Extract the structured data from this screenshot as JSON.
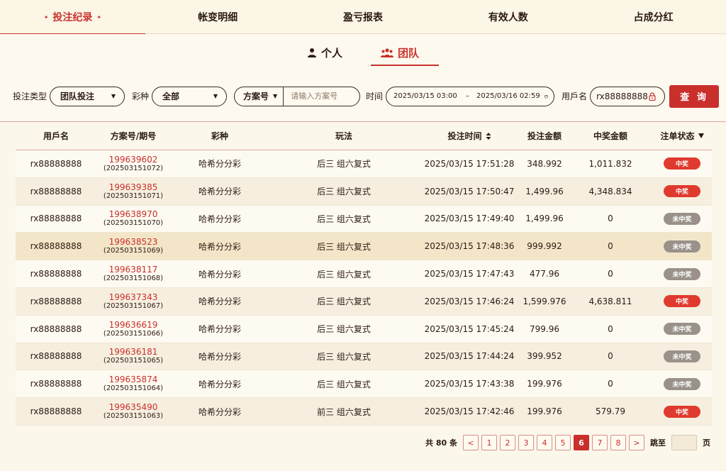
{
  "top_tabs": [
    {
      "label": "投注纪录",
      "active": true
    },
    {
      "label": "帐变明细",
      "active": false
    },
    {
      "label": "盈亏报表",
      "active": false
    },
    {
      "label": "有效人数",
      "active": false
    },
    {
      "label": "占成分红",
      "active": false
    }
  ],
  "sub_tabs": {
    "personal": "个人",
    "team": "团队"
  },
  "filters": {
    "bet_type_label": "投注类型",
    "bet_type_value": "团队投注",
    "lottery_label": "彩种",
    "lottery_value": "全部",
    "plan_select_value": "方案号",
    "plan_input_placeholder": "请输入方案号",
    "time_label": "时间",
    "time_start": "2025/03/15 03:00",
    "time_separator": "–",
    "time_end": "2025/03/16 02:59",
    "username_label": "用戶名",
    "username_value": "rx88888888",
    "query_button": "查 询"
  },
  "table": {
    "headers": {
      "user": "用戶名",
      "plan": "方案号/期号",
      "lottery": "彩种",
      "play": "玩法",
      "time": "投注时间",
      "bet_amount": "投注金额",
      "win_amount": "中奖金额",
      "status": "注单状态"
    },
    "rows": [
      {
        "user": "rx88888888",
        "plan": "199639602",
        "issue": "(202503151072)",
        "lottery": "哈希分分彩",
        "play": "后三 组六复式",
        "time": "2025/03/15 17:51:28",
        "bet": "348.992",
        "win": "1,011.832",
        "status": "中奖"
      },
      {
        "user": "rx88888888",
        "plan": "199639385",
        "issue": "(202503151071)",
        "lottery": "哈希分分彩",
        "play": "后三 组六复式",
        "time": "2025/03/15 17:50:47",
        "bet": "1,499.96",
        "win": "4,348.834",
        "status": "中奖"
      },
      {
        "user": "rx88888888",
        "plan": "199638970",
        "issue": "(202503151070)",
        "lottery": "哈希分分彩",
        "play": "后三 组六复式",
        "time": "2025/03/15 17:49:40",
        "bet": "1,499.96",
        "win": "0",
        "status": "未中奖"
      },
      {
        "user": "rx88888888",
        "plan": "199638523",
        "issue": "(202503151069)",
        "lottery": "哈希分分彩",
        "play": "后三 组六复式",
        "time": "2025/03/15 17:48:36",
        "bet": "999.992",
        "win": "0",
        "status": "未中奖"
      },
      {
        "user": "rx88888888",
        "plan": "199638117",
        "issue": "(202503151068)",
        "lottery": "哈希分分彩",
        "play": "后三 组六复式",
        "time": "2025/03/15 17:47:43",
        "bet": "477.96",
        "win": "0",
        "status": "未中奖"
      },
      {
        "user": "rx88888888",
        "plan": "199637343",
        "issue": "(202503151067)",
        "lottery": "哈希分分彩",
        "play": "后三 组六复式",
        "time": "2025/03/15 17:46:24",
        "bet": "1,599.976",
        "win": "4,638.811",
        "status": "中奖"
      },
      {
        "user": "rx88888888",
        "plan": "199636619",
        "issue": "(202503151066)",
        "lottery": "哈希分分彩",
        "play": "后三 组六复式",
        "time": "2025/03/15 17:45:24",
        "bet": "799.96",
        "win": "0",
        "status": "未中奖"
      },
      {
        "user": "rx88888888",
        "plan": "199636181",
        "issue": "(202503151065)",
        "lottery": "哈希分分彩",
        "play": "后三 组六复式",
        "time": "2025/03/15 17:44:24",
        "bet": "399.952",
        "win": "0",
        "status": "未中奖"
      },
      {
        "user": "rx88888888",
        "plan": "199635874",
        "issue": "(202503151064)",
        "lottery": "哈希分分彩",
        "play": "后三 组六复式",
        "time": "2025/03/15 17:43:38",
        "bet": "199.976",
        "win": "0",
        "status": "未中奖"
      },
      {
        "user": "rx88888888",
        "plan": "199635490",
        "issue": "(202503151063)",
        "lottery": "哈希分分彩",
        "play": "前三 组六复式",
        "time": "2025/03/15 17:42:46",
        "bet": "199.976",
        "win": "579.79",
        "status": "中奖"
      }
    ]
  },
  "pagination": {
    "total_text": "共 80 条",
    "prev": "<",
    "next": ">",
    "pages": [
      "1",
      "2",
      "3",
      "4",
      "5",
      "6",
      "7",
      "8"
    ],
    "current": "6",
    "goto_label": "跳至",
    "page_suffix": "页"
  },
  "colors": {
    "accent": "#c9302c",
    "win_badge": "#e03a2f",
    "lose_badge": "#9a928a"
  },
  "icons": {
    "personal": "person-icon",
    "team": "team-icon",
    "calendar": "calendar-icon",
    "lock": "lock-icon",
    "sort": "sort-icon",
    "filter": "filter-down-icon"
  }
}
